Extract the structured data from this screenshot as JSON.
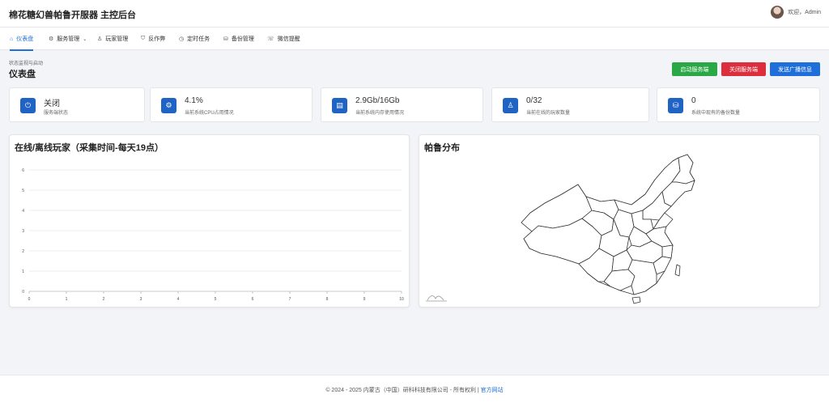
{
  "app": {
    "title": "棉花糖幻兽帕鲁开服器 主控后台"
  },
  "user": {
    "welcome": "欢迎，Admin"
  },
  "nav": [
    {
      "label": "仪表盘",
      "icon": "home-icon",
      "glyph": "⌂",
      "active": true
    },
    {
      "label": "服务管理",
      "icon": "gear-icon",
      "glyph": "⚙",
      "dropdown": true
    },
    {
      "label": "玩家管理",
      "icon": "user-icon",
      "glyph": "♙"
    },
    {
      "label": "反作弊",
      "icon": "shield-icon",
      "glyph": "⛉"
    },
    {
      "label": "定时任务",
      "icon": "clock-icon",
      "glyph": "◷"
    },
    {
      "label": "备份管理",
      "icon": "database-icon",
      "glyph": "⛁"
    },
    {
      "label": "微信提醒",
      "icon": "wechat-icon",
      "glyph": "☏"
    }
  ],
  "page": {
    "breadcrumb": "状态监视与启动",
    "title": "仪表盘"
  },
  "actions": {
    "start": "启动服务端",
    "stop": "关闭服务端",
    "broadcast": "发送广播信息"
  },
  "stats": [
    {
      "value": "关闭",
      "label": "服务端状态",
      "icon": "power-icon",
      "glyph": "⏻"
    },
    {
      "value": "4.1%",
      "label": "当前系统CPU占用情况",
      "icon": "cpu-icon",
      "glyph": "⚙"
    },
    {
      "value": "2.9Gb/16Gb",
      "label": "当前系统内存使用情况",
      "icon": "memory-icon",
      "glyph": "▤"
    },
    {
      "value": "0/32",
      "label": "当前在线的玩家数量",
      "icon": "player-icon",
      "glyph": "♙"
    },
    {
      "value": "0",
      "label": "系统中现有的备份数量",
      "icon": "database-icon",
      "glyph": "⛁"
    }
  ],
  "panels": {
    "players_title": "在线/离线玩家（采集时间-每天19点）",
    "map_title": "帕鲁分布"
  },
  "chart_data": {
    "type": "line",
    "title": "在线/离线玩家（采集时间-每天19点）",
    "x": [
      0,
      1,
      2,
      3,
      4,
      5,
      6,
      7,
      8,
      9,
      10
    ],
    "xlim": [
      0,
      10
    ],
    "ylim": [
      0,
      6
    ],
    "yticks": [
      0,
      1,
      2,
      3,
      4,
      5,
      6
    ],
    "series": [],
    "grid": true,
    "gridColor": "#e8e8e8"
  },
  "footer": {
    "text": "© 2024 - 2025 内蒙古（中国）研科科技有限公司 - 所有权利 | ",
    "link": "官方网站"
  },
  "colors": {
    "accent": "#1e6fd9",
    "start": "#2aa845",
    "stop": "#dd2e3d",
    "iconBg": "#1f64c4"
  }
}
